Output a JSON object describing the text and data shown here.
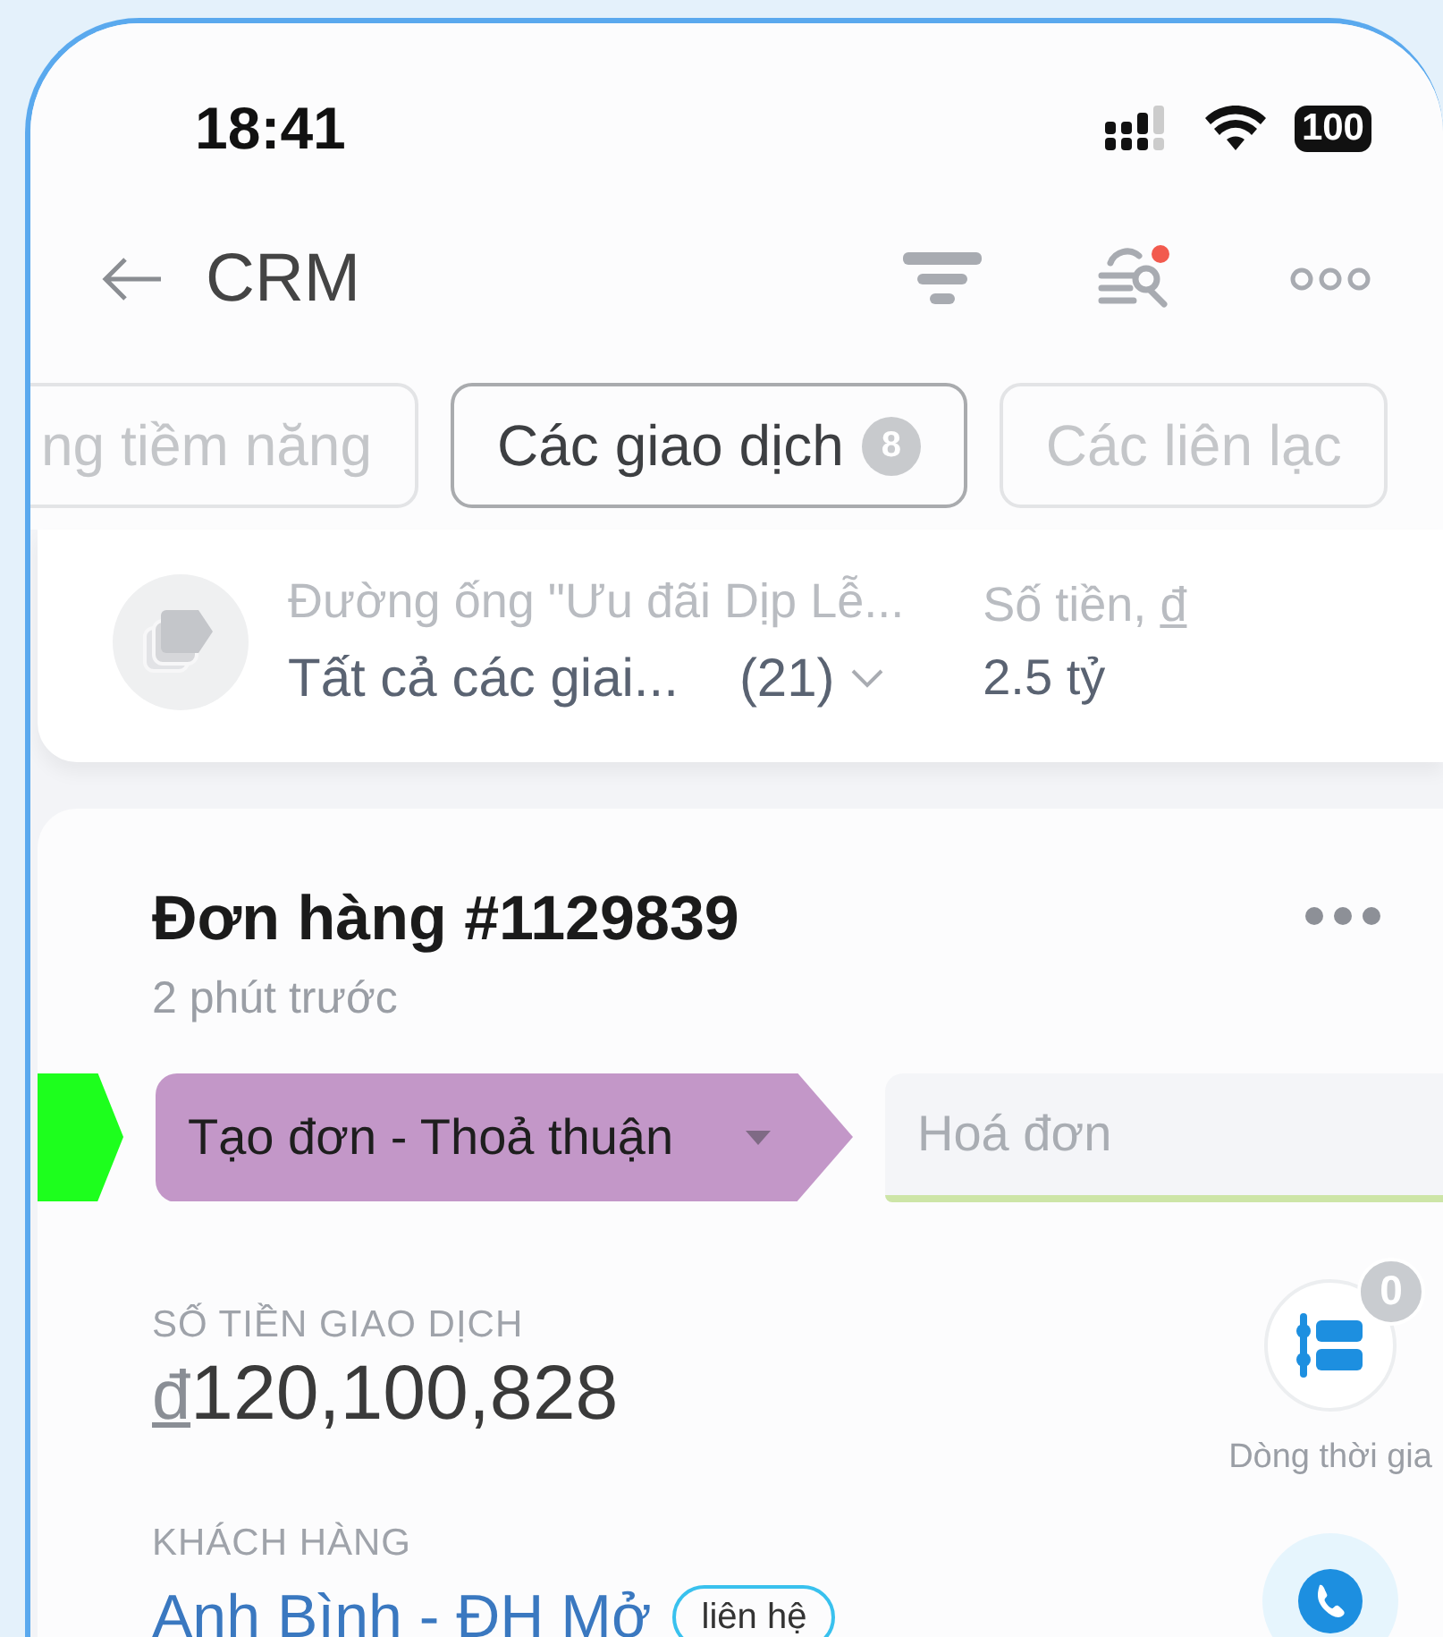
{
  "status_bar": {
    "time": "18:41",
    "battery": "100"
  },
  "header": {
    "title": "CRM",
    "notification_dot": true
  },
  "tabs": [
    {
      "label": "ng tiềm năng",
      "selected": false
    },
    {
      "label": "Các giao dịch",
      "count": "8",
      "selected": true
    },
    {
      "label": "Các liên lạc",
      "selected": false
    }
  ],
  "pipeline_summary": {
    "pipeline": "Đường ống \"Ưu đãi Dịp Lễ...",
    "stage_filter": "Tất cả các giai...",
    "count": "(21)",
    "amount_label": "Số tiền,",
    "currency": "đ",
    "amount": "2.5 tỷ"
  },
  "deal": {
    "title": "Đơn hàng #1129839",
    "time": "2 phút trước",
    "stages": [
      {
        "kind": "done",
        "color": "#1dff1d"
      },
      {
        "kind": "current",
        "label": "Tạo đơn - Thoả thuận",
        "color": "#c397c8"
      },
      {
        "kind": "next",
        "label": "Hoá đơn"
      }
    ],
    "amount_label": "SỐ TIỀN GIAO DỊCH",
    "currency": "đ",
    "amount": "120,100,828",
    "timeline": {
      "label": "Dòng thời gia",
      "count": "0"
    },
    "client_label": "KHÁCH HÀNG",
    "client": "Anh Bình - ĐH Mở",
    "client_tag": "liên hệ"
  }
}
